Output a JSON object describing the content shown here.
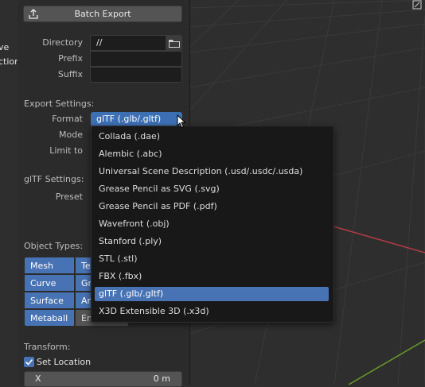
{
  "viewport": {
    "clipped_labels": [
      "ve",
      "ction"
    ]
  },
  "panel": {
    "batch_export_label": "Batch Export",
    "directory_label": "Directory",
    "directory_value": "//",
    "prefix_label": "Prefix",
    "prefix_value": "",
    "suffix_label": "Suffix",
    "suffix_value": "",
    "export_settings_title": "Export Settings:",
    "format_label": "Format",
    "format_value": "glTF (.glb/.gltf)",
    "mode_label": "Mode",
    "limit_to_label": "Limit to",
    "gltf_settings_title": "glTF Settings:",
    "preset_label": "Preset",
    "object_types_title": "Object Types:",
    "object_types": [
      {
        "label": "Mesh",
        "enabled": true
      },
      {
        "label": "Te",
        "enabled": true
      },
      {
        "label": "Curve",
        "enabled": true
      },
      {
        "label": "Gr",
        "enabled": true
      },
      {
        "label": "Surface",
        "enabled": true
      },
      {
        "label": "Ar",
        "enabled": true
      },
      {
        "label": "Metaball",
        "enabled": true
      },
      {
        "label": "Em",
        "enabled": false
      }
    ],
    "transform_title": "Transform:",
    "set_location_label": "Set Location",
    "set_location_checked": true,
    "x_label": "X",
    "x_value": "0 m"
  },
  "format_menu": {
    "items": [
      "Collada (.dae)",
      "Alembic (.abc)",
      "Universal Scene Description (.usd/.usdc/.usda)",
      "Grease Pencil as SVG (.svg)",
      "Grease Pencil as PDF (.pdf)",
      "Wavefront (.obj)",
      "Stanford (.ply)",
      "STL (.stl)",
      "FBX (.fbx)",
      "glTF (.glb/.gltf)",
      "X3D Extensible 3D (.x3d)"
    ],
    "selected": "glTF (.glb/.gltf)"
  },
  "colors": {
    "accent": "#4772b3",
    "panel_bg": "#2b2b2b",
    "viewport_bg": "#2e2e2e",
    "grid_line": "#3a3a3a",
    "axis_x": "#b23a44",
    "axis_y": "#6a9a2a"
  },
  "icons": [
    "export-icon",
    "folder-icon",
    "chevron-down-icon",
    "checkbox-checked-icon",
    "mouse-cursor-icon",
    "viewport-gizmo-icon"
  ]
}
